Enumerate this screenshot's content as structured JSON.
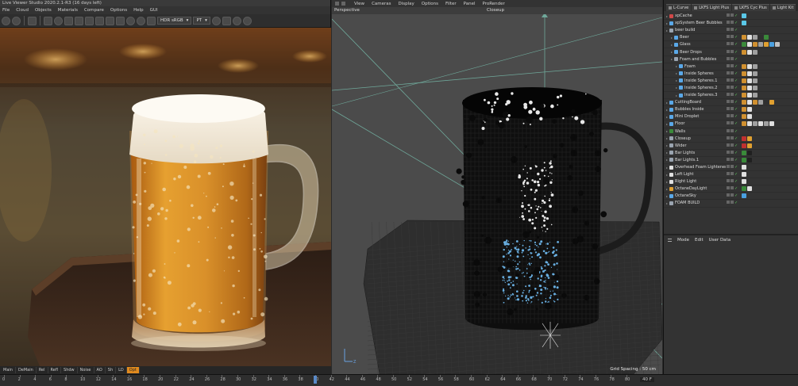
{
  "live_viewer": {
    "title": "Live Viewer Studio 2020.2.1-R3 (16 days left)",
    "menu": [
      "File",
      "Cloud",
      "Objects",
      "Materials",
      "Compare",
      "Options",
      "Help",
      "GUI"
    ],
    "color_space": "HDR sRGB",
    "render_kernel": "PT",
    "status_tabs": [
      "Main",
      "DeMain",
      "Rel",
      "Refl",
      "Shdw",
      "Noise",
      "AO",
      "Sh",
      "LD",
      "Opt"
    ],
    "active_status_tab": "Opt"
  },
  "viewport": {
    "menu": [
      "View",
      "Cameras",
      "Display",
      "Options",
      "Filter",
      "Panel",
      "ProRender"
    ],
    "view_name": "Perspective",
    "camera_name": "Closeup",
    "grid_spacing": "Grid Spacing : 50 cm"
  },
  "object_manager": {
    "tabs": [
      "L-Curve",
      "LKFS Light Plus",
      "LKFS Cyc Plus",
      "Light Kit"
    ],
    "objects": [
      {
        "name": "xpCache",
        "indent": 0,
        "icon_color": "#d04848",
        "tags": [
          "#5ac8e8"
        ]
      },
      {
        "name": "xpSystem Beer Bubbles",
        "indent": 0,
        "icon_color": "#5aa8e8",
        "tags": [
          "#5ac8e8"
        ]
      },
      {
        "name": "beer build",
        "indent": 0,
        "icon_color": "#9aa4b0",
        "tags": []
      },
      {
        "name": "Beer",
        "indent": 1,
        "icon_color": "#5aa8e8",
        "tags": [
          "#d09030",
          "#e0e0e0",
          "#a0a0a0",
          "#303030",
          "#3a8a3a"
        ]
      },
      {
        "name": "Glass",
        "indent": 1,
        "icon_color": "#5aa8e8",
        "tags": [
          "#3a8a3a",
          "#e0e0e0",
          "#d09030",
          "#a0a0a0",
          "#e0a030",
          "#4aa0e0",
          "#c0c0c0"
        ]
      },
      {
        "name": "Beer Drops",
        "indent": 1,
        "icon_color": "#5aa8e8",
        "tags": [
          "#d09030",
          "#e0e0e0",
          "#a0a0a0"
        ]
      },
      {
        "name": "Foam and Bubbles",
        "indent": 1,
        "icon_color": "#9aa4b0",
        "tags": []
      },
      {
        "name": "Foam",
        "indent": 2,
        "icon_color": "#5aa8e8",
        "tags": [
          "#d09030",
          "#e0e0e0",
          "#a0a0a0"
        ]
      },
      {
        "name": "Inside Spheres",
        "indent": 2,
        "icon_color": "#5aa8e8",
        "tags": [
          "#d09030",
          "#e0e0e0",
          "#a0a0a0"
        ]
      },
      {
        "name": "Inside Spheres.1",
        "indent": 2,
        "icon_color": "#5aa8e8",
        "tags": [
          "#d09030",
          "#e0e0e0",
          "#a0a0a0"
        ]
      },
      {
        "name": "Inside Spheres.2",
        "indent": 2,
        "icon_color": "#5aa8e8",
        "tags": [
          "#d09030",
          "#e0e0e0",
          "#a0a0a0"
        ]
      },
      {
        "name": "Inside Spheres.3",
        "indent": 2,
        "icon_color": "#5aa8e8",
        "tags": [
          "#d09030",
          "#e0e0e0",
          "#a0a0a0"
        ]
      },
      {
        "name": "CuttingBoard",
        "indent": 0,
        "icon_color": "#5aa8e8",
        "tags": [
          "#d09030",
          "#e0e0e0",
          "#d09030",
          "#a0a0a0",
          "#303030",
          "#e0a030"
        ]
      },
      {
        "name": "Bubbles Inside",
        "indent": 0,
        "icon_color": "#5aa8e8",
        "tags": [
          "#d09030",
          "#e0e0e0"
        ]
      },
      {
        "name": "Mini Droplet",
        "indent": 0,
        "icon_color": "#5aa8e8",
        "tags": [
          "#d09030",
          "#e0e0e0"
        ]
      },
      {
        "name": "Floor",
        "indent": 0,
        "icon_color": "#5aa8e8",
        "tags": [
          "#d09030",
          "#e0e0e0",
          "#a0a0a0",
          "#e0e0e0",
          "#a0a0a0",
          "#e0e0e0"
        ]
      },
      {
        "name": "Walls",
        "indent": 0,
        "icon_color": "#3a8a3a",
        "tags": []
      },
      {
        "name": "Closeup",
        "indent": 0,
        "icon_color": "#9aa4b0",
        "tags": [
          "#c03030",
          "#e0a030"
        ]
      },
      {
        "name": "Wider",
        "indent": 0,
        "icon_color": "#9aa4b0",
        "tags": [
          "#c03030",
          "#e0a030"
        ]
      },
      {
        "name": "Bar Lights",
        "indent": 0,
        "icon_color": "#9aa4b0",
        "tags": [
          "#3a8a3a",
          "#202020"
        ]
      },
      {
        "name": "Bar Lights.1",
        "indent": 0,
        "icon_color": "#9aa4b0",
        "tags": [
          "#3a8a3a",
          "#202020"
        ]
      },
      {
        "name": "Overhead Foam Lightener",
        "indent": 0,
        "icon_color": "#e0e0e0",
        "tags": [
          "#e0e0e0"
        ]
      },
      {
        "name": "Left Light",
        "indent": 0,
        "icon_color": "#e0e0e0",
        "tags": [
          "#e0e0e0"
        ]
      },
      {
        "name": "Right Light",
        "indent": 0,
        "icon_color": "#e0e0e0",
        "tags": [
          "#e0e0e0"
        ]
      },
      {
        "name": "OctaneDayLight",
        "indent": 0,
        "icon_color": "#e0a030",
        "tags": [
          "#3a8a3a",
          "#e0e0e0"
        ]
      },
      {
        "name": "OctaneSky",
        "indent": 0,
        "icon_color": "#5aa8e8",
        "tags": [
          "#4aa0e0"
        ]
      },
      {
        "name": "FOAM BUILD",
        "indent": 0,
        "icon_color": "#9aa4b0",
        "tags": []
      }
    ],
    "attr_menu": [
      "Mode",
      "Edit",
      "User Data"
    ]
  },
  "timeline": {
    "ticks": [
      "0",
      "2",
      "4",
      "6",
      "8",
      "10",
      "12",
      "14",
      "16",
      "18",
      "20",
      "22",
      "24",
      "26",
      "28",
      "30",
      "32",
      "34",
      "36",
      "38",
      "40",
      "42",
      "44",
      "46",
      "48",
      "50",
      "52",
      "54",
      "56",
      "58",
      "60",
      "62",
      "64",
      "66",
      "68",
      "70",
      "72",
      "74",
      "76",
      "78",
      "80"
    ],
    "current_frame": 40,
    "end_label": "40 F"
  }
}
